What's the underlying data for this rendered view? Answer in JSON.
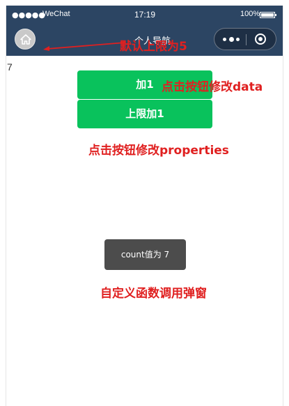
{
  "status_bar": {
    "signal": "●●●●●",
    "carrier": "WeChat",
    "time": "17:19",
    "battery_percent": "100%"
  },
  "nav_bar": {
    "title": "个人导航",
    "home_icon": "home-icon",
    "more_icon": "more-dots-icon",
    "close_icon": "target-close-icon"
  },
  "content": {
    "count_value": "7",
    "add_button_label": "加1",
    "limit_button_label": "上限加1",
    "toast_text": "count值为 7"
  },
  "annotations": {
    "limit_note": "默认上限为5",
    "data_note": "点击按钮修改data",
    "properties_note": "点击按钮修改properties",
    "toast_note": "自定义函数调用弹窗"
  },
  "colors": {
    "nav_bg": "#2c4563",
    "button_green": "#09c25c",
    "toast_bg": "#4c4c4c",
    "annotation_red": "#e02020"
  }
}
